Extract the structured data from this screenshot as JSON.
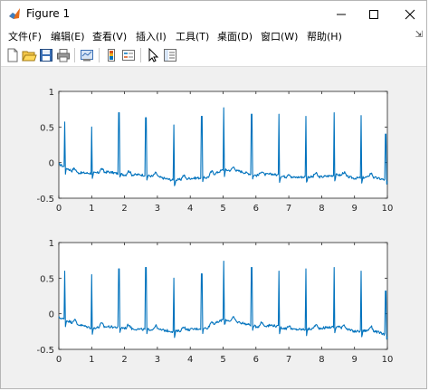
{
  "window": {
    "title": "Figure 1",
    "controls": [
      "minimize-icon",
      "maximize-icon",
      "close-icon"
    ]
  },
  "menu": {
    "items": [
      {
        "label": "文件(F)"
      },
      {
        "label": "编辑(E)"
      },
      {
        "label": "查看(V)"
      },
      {
        "label": "插入(I)"
      },
      {
        "label": "工具(T)"
      },
      {
        "label": "桌面(D)"
      },
      {
        "label": "窗口(W)"
      },
      {
        "label": "帮助(H)"
      }
    ],
    "dock_icon": "⇲"
  },
  "toolbar": {
    "icons": [
      "new-figure-icon",
      "open-file-icon",
      "save-icon",
      "print-icon",
      "link-plot-icon",
      "colorbar-icon",
      "legend-icon",
      "edit-plot-icon",
      "property-inspector-icon"
    ]
  },
  "colors": {
    "line": "#0072bd",
    "axes_bg": "#ffffff",
    "figure_bg": "#f0f0f0"
  },
  "chart_data": [
    {
      "type": "line",
      "title": "",
      "xlabel": "",
      "ylabel": "",
      "xlim": [
        0,
        10
      ],
      "ylim": [
        -0.5,
        1
      ],
      "xticks": [
        "0",
        "1",
        "2",
        "3",
        "4",
        "5",
        "6",
        "7",
        "8",
        "9",
        "10"
      ],
      "yticks": [
        "-0.5",
        "0",
        "0.5",
        "1"
      ],
      "grid": false,
      "series": [
        {
          "beats": [
            {
              "t": 0.18,
              "peak": 0.57
            },
            {
              "t": 1.0,
              "peak": 0.5
            },
            {
              "t": 1.83,
              "peak": 0.7
            },
            {
              "t": 2.65,
              "peak": 0.63
            },
            {
              "t": 3.5,
              "peak": 0.53
            },
            {
              "t": 4.35,
              "peak": 0.65
            },
            {
              "t": 5.02,
              "peak": 0.77
            },
            {
              "t": 5.87,
              "peak": 0.68
            },
            {
              "t": 6.7,
              "peak": 0.68
            },
            {
              "t": 7.52,
              "peak": 0.65
            },
            {
              "t": 8.38,
              "peak": 0.7
            },
            {
              "t": 9.2,
              "peak": 0.66
            },
            {
              "t": 9.95,
              "peak": 0.4
            }
          ],
          "baseline": [
            [
              0,
              -0.02
            ],
            [
              0.5,
              -0.14
            ],
            [
              1.0,
              -0.15
            ],
            [
              1.5,
              -0.13
            ],
            [
              2.0,
              -0.17
            ],
            [
              2.5,
              -0.17
            ],
            [
              3.0,
              -0.2
            ],
            [
              3.5,
              -0.25
            ],
            [
              4.0,
              -0.22
            ],
            [
              4.5,
              -0.21
            ],
            [
              5.0,
              -0.1
            ],
            [
              5.5,
              -0.12
            ],
            [
              6.0,
              -0.18
            ],
            [
              6.5,
              -0.16
            ],
            [
              7.0,
              -0.21
            ],
            [
              7.5,
              -0.2
            ],
            [
              8.0,
              -0.2
            ],
            [
              8.5,
              -0.17
            ],
            [
              9.0,
              -0.22
            ],
            [
              9.5,
              -0.2
            ],
            [
              10.0,
              -0.25
            ]
          ]
        }
      ]
    },
    {
      "type": "line",
      "title": "",
      "xlabel": "",
      "ylabel": "",
      "xlim": [
        0,
        10
      ],
      "ylim": [
        -0.5,
        1
      ],
      "xticks": [
        "0",
        "1",
        "2",
        "3",
        "4",
        "5",
        "6",
        "7",
        "8",
        "9",
        "10"
      ],
      "yticks": [
        "-0.5",
        "0",
        "0.5",
        "1"
      ],
      "grid": false,
      "series": [
        {
          "beats": [
            {
              "t": 0.18,
              "peak": 0.6
            },
            {
              "t": 1.0,
              "peak": 0.55
            },
            {
              "t": 1.83,
              "peak": 0.63
            },
            {
              "t": 2.65,
              "peak": 0.65
            },
            {
              "t": 3.5,
              "peak": 0.5
            },
            {
              "t": 4.35,
              "peak": 0.56
            },
            {
              "t": 5.02,
              "peak": 0.74
            },
            {
              "t": 5.87,
              "peak": 0.65
            },
            {
              "t": 6.7,
              "peak": 0.6
            },
            {
              "t": 7.52,
              "peak": 0.63
            },
            {
              "t": 8.38,
              "peak": 0.65
            },
            {
              "t": 9.2,
              "peak": 0.6
            },
            {
              "t": 9.95,
              "peak": 0.32
            }
          ],
          "baseline": [
            [
              0,
              -0.05
            ],
            [
              0.5,
              -0.14
            ],
            [
              1.0,
              -0.2
            ],
            [
              1.5,
              -0.18
            ],
            [
              2.0,
              -0.2
            ],
            [
              2.5,
              -0.22
            ],
            [
              3.0,
              -0.22
            ],
            [
              3.5,
              -0.25
            ],
            [
              4.0,
              -0.22
            ],
            [
              4.5,
              -0.2
            ],
            [
              5.0,
              -0.08
            ],
            [
              5.5,
              -0.12
            ],
            [
              6.0,
              -0.18
            ],
            [
              6.5,
              -0.16
            ],
            [
              7.0,
              -0.22
            ],
            [
              7.5,
              -0.22
            ],
            [
              8.0,
              -0.2
            ],
            [
              8.5,
              -0.18
            ],
            [
              9.0,
              -0.25
            ],
            [
              9.5,
              -0.23
            ],
            [
              10.0,
              -0.3
            ]
          ]
        }
      ]
    }
  ]
}
